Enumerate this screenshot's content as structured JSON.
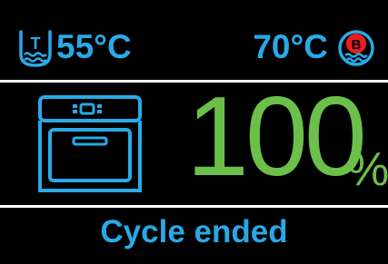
{
  "colors": {
    "background": "#000000",
    "accent_blue": "#29a9e6",
    "progress_green": "#6cc04a",
    "icon_red": "#e81e1e",
    "divider": "#ffffff"
  },
  "header": {
    "left_icon": "tap-water-temperature-icon",
    "left_icon_letter": "T",
    "left_temperature": "55°C",
    "right_temperature": "70°C",
    "right_icon": "boiling-water-icon",
    "right_icon_letter": "B"
  },
  "main": {
    "appliance_icon": "dishwasher-icon",
    "progress_value": "100",
    "progress_unit": "%",
    "progress_fraction": 1.0
  },
  "footer": {
    "status": "Cycle ended"
  }
}
